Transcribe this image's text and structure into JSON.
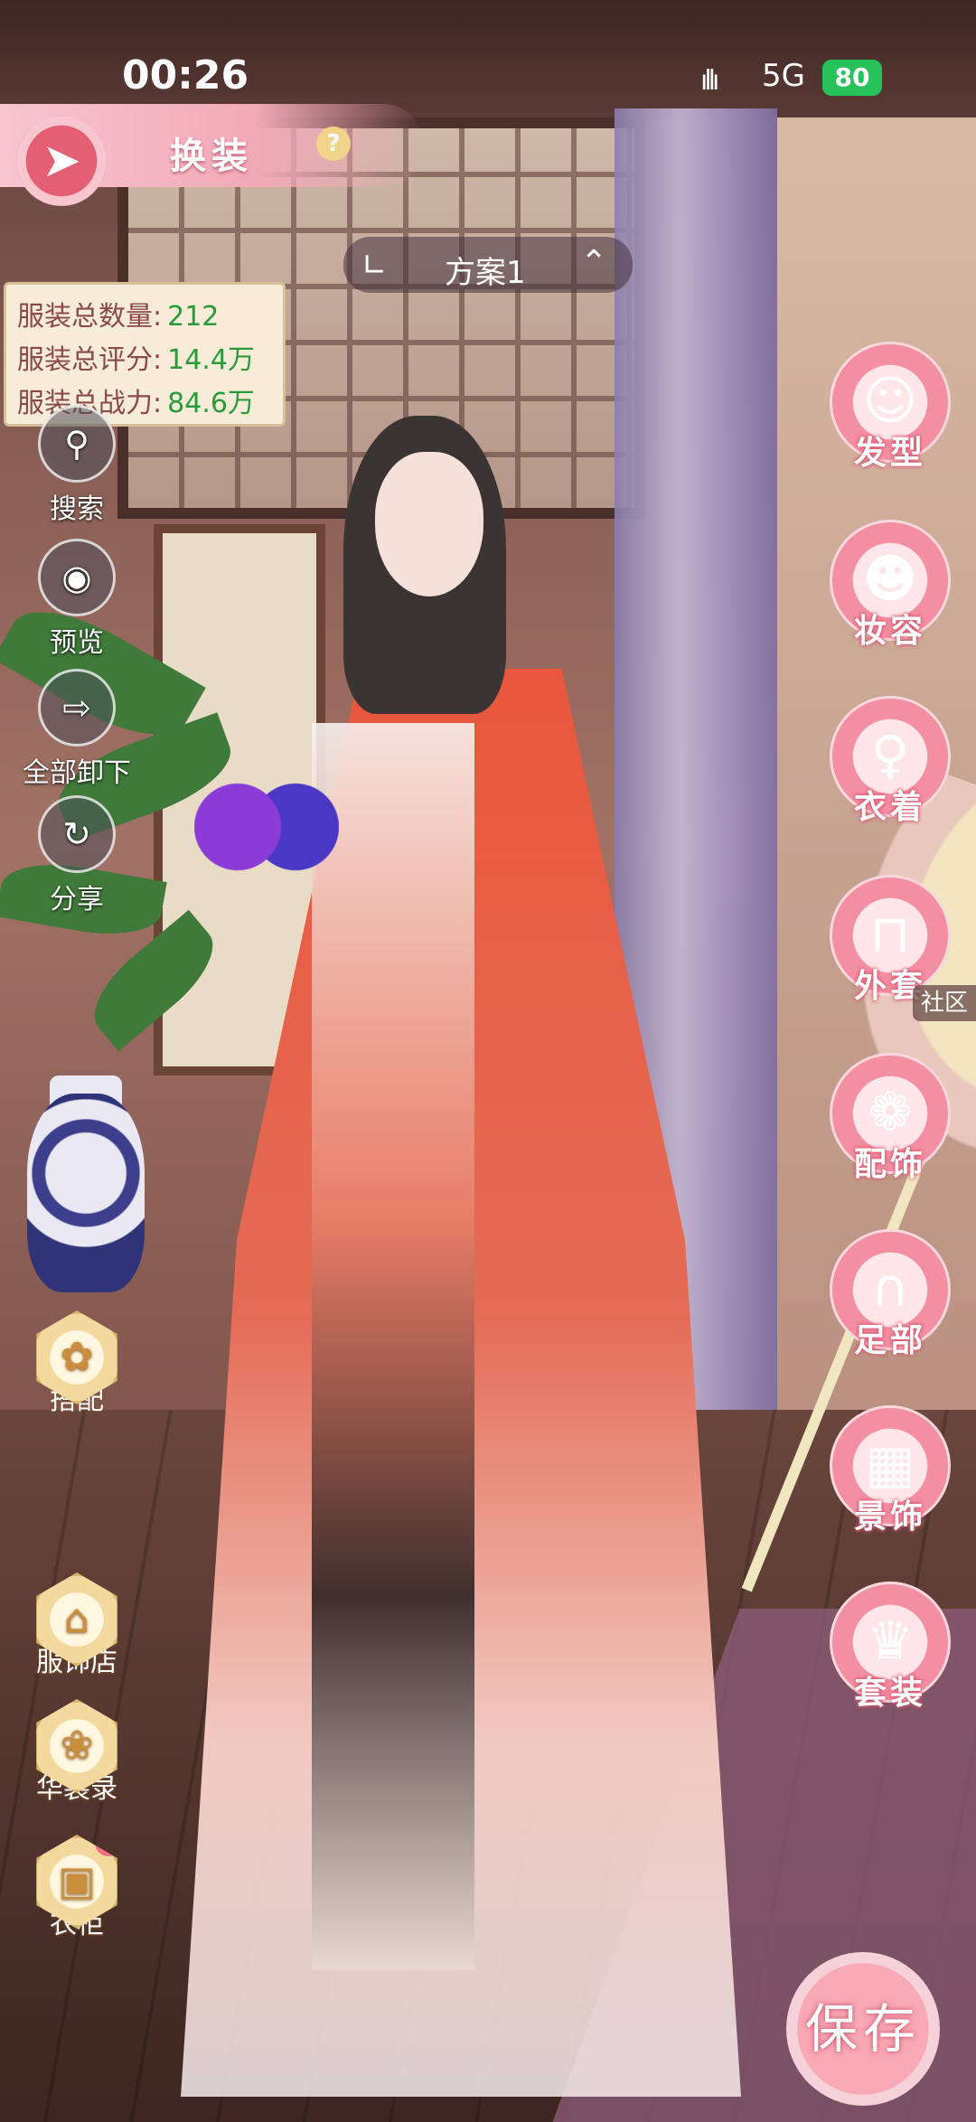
{
  "status_bar": {
    "time": "00:26",
    "signal": "ıllı",
    "network": "5G",
    "battery": "80"
  },
  "header": {
    "title": "换装",
    "help_icon": "question-icon",
    "back_icon": "back-emblem-icon"
  },
  "plan_selector": {
    "label": "方案1"
  },
  "stats": {
    "rows": [
      {
        "label": "服装总数量:",
        "value": "212"
      },
      {
        "label": "服装总评分:",
        "value": "14.4万"
      },
      {
        "label": "服装总战力:",
        "value": "84.6万"
      }
    ]
  },
  "left_tools": [
    {
      "label": "搜索",
      "icon": "search-icon",
      "glyph": "⚲"
    },
    {
      "label": "预览",
      "icon": "eye-icon",
      "glyph": "◉"
    },
    {
      "label": "全部卸下",
      "icon": "undress-icon",
      "glyph": "⇨"
    },
    {
      "label": "分享",
      "icon": "share-icon",
      "glyph": "↻"
    }
  ],
  "left_hex_tools": [
    {
      "label": "搭配",
      "icon": "match-icon",
      "glyph": "✿"
    },
    {
      "label": "服饰店",
      "icon": "shop-icon",
      "glyph": "⌂"
    },
    {
      "label": "华装录",
      "icon": "catalog-icon",
      "glyph": "❀"
    },
    {
      "label": "衣柜",
      "icon": "wardrobe-icon",
      "glyph": "▣"
    }
  ],
  "right_categories": [
    {
      "label": "发型",
      "icon": "hairstyle-icon",
      "glyph": "☺"
    },
    {
      "label": "妆容",
      "icon": "makeup-icon",
      "glyph": "☻"
    },
    {
      "label": "衣着",
      "icon": "clothing-icon",
      "glyph": "♀"
    },
    {
      "label": "外套",
      "icon": "coat-icon",
      "glyph": "⊓"
    },
    {
      "label": "配饰",
      "icon": "accessory-icon",
      "glyph": "❁"
    },
    {
      "label": "足部",
      "icon": "shoes-icon",
      "glyph": "∩"
    },
    {
      "label": "景饰",
      "icon": "scenery-icon",
      "glyph": "▦"
    },
    {
      "label": "套装",
      "icon": "outfit-set-icon",
      "glyph": "♛"
    }
  ],
  "community_label": "社区",
  "save_label": "保存"
}
